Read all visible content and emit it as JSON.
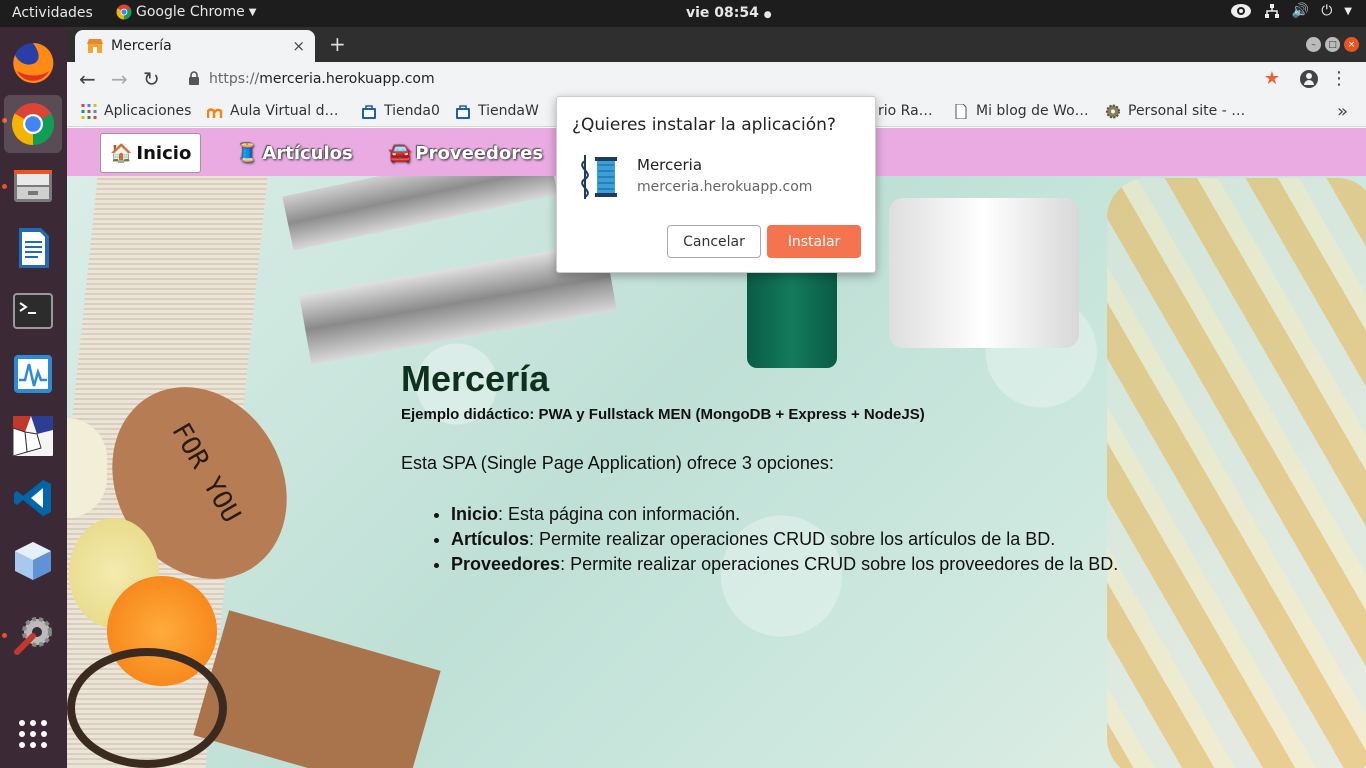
{
  "topbar": {
    "activities": "Actividades",
    "app_name": "Google Chrome",
    "clock": "vie 08:54"
  },
  "dock": {
    "items": [
      "firefox-icon",
      "chrome-icon",
      "files-icon",
      "writer-icon",
      "terminal-icon",
      "system-monitor-icon",
      "drawing-app-icon",
      "vscode-icon",
      "virtualbox-icon",
      "settings-icon",
      "show-apps-icon"
    ]
  },
  "browser": {
    "tab_title": "Mercería",
    "tab_close": "×",
    "new_tab": "+",
    "url_scheme": "https://",
    "url_host": "merceria.herokuapp.com",
    "bookmarks": [
      {
        "label": "Aplicaciones"
      },
      {
        "label": "Aula Virtual d…"
      },
      {
        "label": "Tienda0"
      },
      {
        "label": "TiendaW"
      },
      {
        "label": "rio Ra…"
      },
      {
        "label": "Mi blog de Wo…"
      },
      {
        "label": "Personal site - …"
      }
    ],
    "bookmarks_more": "»"
  },
  "nav": {
    "items": [
      {
        "label": "Inicio",
        "icon": "🏠"
      },
      {
        "label": "Artículos",
        "icon": "🧵"
      },
      {
        "label": "Proveedores",
        "icon": "🚘"
      }
    ]
  },
  "content": {
    "title": "Mercería",
    "subtitle": "Ejemplo didáctico: PWA y Fullstack MEN (MongoDB + Express + NodeJS)",
    "intro": "Esta SPA (Single Page Application) ofrece 3 opciones:",
    "options": [
      {
        "term": "Inicio",
        "desc": ": Esta página con información."
      },
      {
        "term": "Artículos",
        "desc": ": Permite realizar operaciones CRUD sobre los artículos de la BD."
      },
      {
        "term": "Proveedores",
        "desc": ": Permite realizar operaciones CRUD sobre los proveedores de la BD."
      }
    ]
  },
  "dialog": {
    "title": "¿Quieres instalar la aplicación?",
    "app_name": "Merceria",
    "app_url": "merceria.herokuapp.com",
    "cancel": "Cancelar",
    "install": "Instalar"
  },
  "colors": {
    "nav_bg": "#e9abe1",
    "install_button": "#f4744f",
    "dock_bg": "#3b2a35",
    "ubuntu_accent": "#e95420"
  }
}
